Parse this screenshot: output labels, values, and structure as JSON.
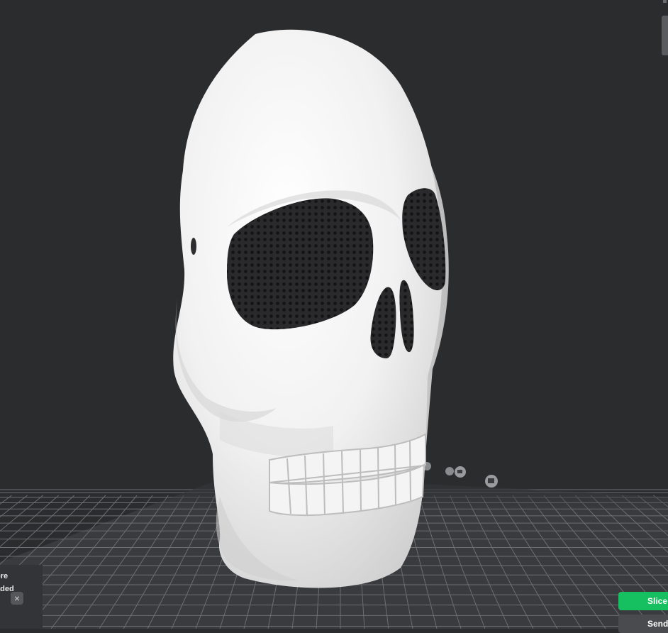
{
  "viewport": {
    "background": "#2b2c2e",
    "model": "skull-mask",
    "bed_grid_color": "#6d6e72"
  },
  "notification": {
    "line1": "ore",
    "line2": "aded",
    "close_icon": "close-icon"
  },
  "actions": {
    "slice_label": "Slice",
    "send_label": "Send",
    "accent": "#16c060"
  }
}
